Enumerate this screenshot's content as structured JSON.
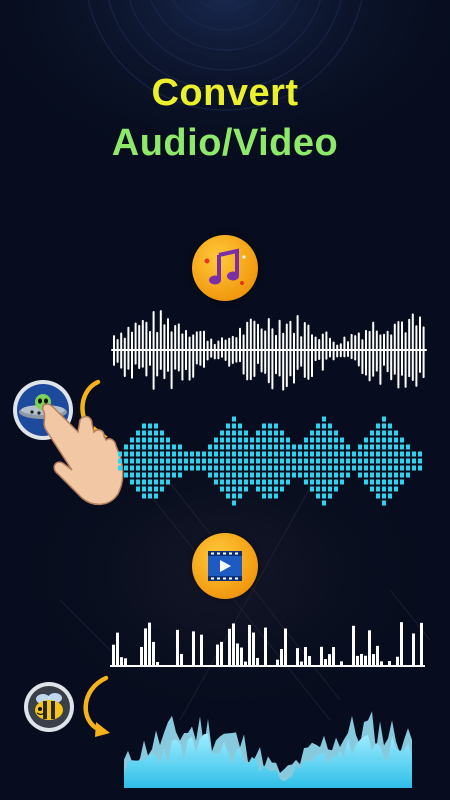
{
  "headline": {
    "line1": "Convert",
    "line2": "Audio/Video"
  },
  "colors": {
    "background": "#070d1e",
    "headline_line1": "#ecf02b",
    "headline_line2": "#8ee86a",
    "waveform_white": "#ffffff",
    "equalizer_cyan": "#2bd5f0",
    "spectrum_fill": "#3ccdf0",
    "spectrum_highlight": "#9fecff",
    "badge_orange": "#f5a313",
    "arrow_yellow": "#f6b21b"
  },
  "icons": {
    "music_badge": "music-note-icon",
    "video_badge": "video-play-icon",
    "alien_avatar": "alien-ufo-icon",
    "bee_avatar": "bee-icon",
    "hand": "pointing-hand-icon",
    "arrows": "curved-arrow-icon"
  }
}
